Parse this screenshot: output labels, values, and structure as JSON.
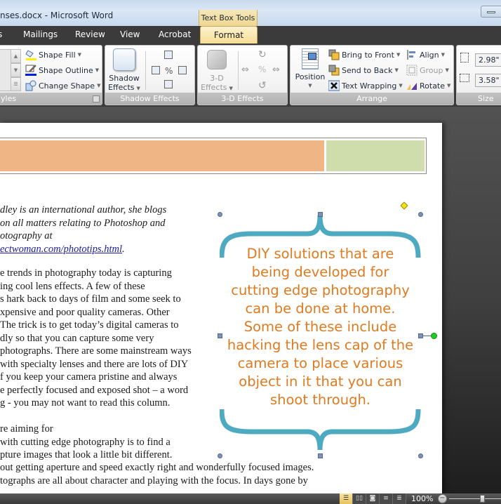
{
  "window": {
    "title": "nses.docx - Microsoft Word",
    "contextual_tab_group": "Text Box Tools"
  },
  "tabs": [
    {
      "label": "s",
      "active": false
    },
    {
      "label": "Mailings",
      "active": false
    },
    {
      "label": "Review",
      "active": false
    },
    {
      "label": "View",
      "active": false
    },
    {
      "label": "Acrobat",
      "active": false
    },
    {
      "label": "Format",
      "active": true
    }
  ],
  "ribbon": {
    "text_box_styles": {
      "label": "yles",
      "shape_fill": "Shape Fill",
      "shape_outline": "Shape Outline",
      "change_shape": "Change Shape"
    },
    "shadow_effects": {
      "label": "Shadow Effects",
      "button_line1": "Shadow",
      "button_line2": "Effects"
    },
    "three_d_effects": {
      "label": "3-D Effects",
      "button_line1": "3-D",
      "button_line2": "Effects"
    },
    "arrange": {
      "label": "Arrange",
      "position": "Position",
      "bring_to_front": "Bring to Front",
      "send_to_back": "Send to Back",
      "text_wrapping": "Text Wrapping",
      "align": "Align",
      "group": "Group",
      "rotate": "Rotate"
    },
    "size": {
      "label": "Size",
      "height": "2.98\"",
      "width": "3.58\""
    }
  },
  "document": {
    "header_colors": {
      "left": "#f0b585",
      "right": "#cfddad"
    },
    "bio_lines": [
      "dley is an international author, she blogs",
      "on all matters relating to Photoshop and",
      "otography at"
    ],
    "bio_link": "ectwoman.com/phototips.html",
    "bio_link_suffix": ".",
    "paragraph1": [
      "e trends in photography today is capturing",
      "ing  cool lens effects. A few of these",
      "s hark back to days of film and some seek to",
      "xpensive and poor quality cameras.  Other",
      "The trick is to get today’s digital cameras  to",
      "dly so that you can capture some very",
      "photographs. There are some mainstream  ways",
      "with specialty lenses and there are lots of DIY",
      "f you keep  your camera pristine and always",
      "e perfectly focused and exposed shot – a word",
      "g - you may not want to read this column."
    ],
    "paragraph2": [
      "re aiming  for",
      "with cutting edge photography is  to find a",
      "pture images  that look a little bit different."
    ],
    "paragraph3": [
      "out getting aperture and speed exactly right and wonderfully focused images.",
      "tographs are all  about character and playing  with the focus. In days gone by"
    ],
    "text_box": {
      "text": "DIY solutions that are being developed for cutting edge photography can be done at home. Some of these include hacking the lens cap of the camera to place various object in it that you can shoot through.",
      "text_color": "#e07a1f",
      "brace_color": "#4eaac1"
    }
  },
  "statusbar": {
    "view_buttons": [
      "Print Layout",
      "Full Screen Reading",
      "Web Layout",
      "Outline",
      "Draft"
    ],
    "zoom_level": "100%"
  }
}
